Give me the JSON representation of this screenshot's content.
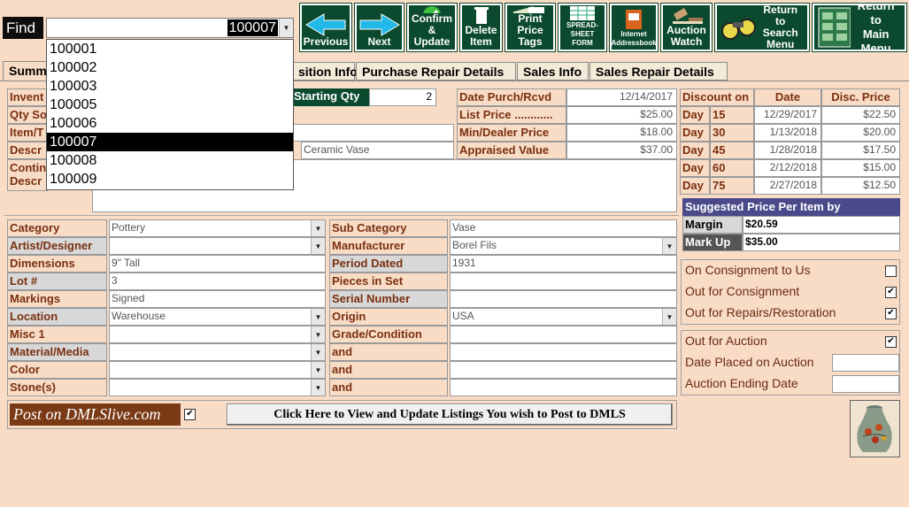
{
  "find": {
    "label": "Find",
    "value": "100007",
    "options": [
      "100001",
      "100002",
      "100003",
      "100005",
      "100006",
      "100007",
      "100008",
      "100009"
    ]
  },
  "toolbar": {
    "previous": "Previous",
    "next": "Next",
    "confirm1": "Confirm",
    "confirm2": "& Update",
    "delete1": "Delete",
    "delete2": "Item",
    "print1": "Print",
    "print2": "Price Tags",
    "spread1": "SPREAD-",
    "spread2": "SHEET",
    "spread3": "FORM",
    "internet1": "Internet",
    "internet2": "Addressbook",
    "auction1": "Auction",
    "auction2": "Watch",
    "search1": "Return to",
    "search2": "Search",
    "search3": "Menu",
    "main1": "Return to",
    "main2": "Main",
    "main3": "Menu"
  },
  "tabs": [
    "Summ",
    "sition Info",
    "Purchase Repair Details",
    "Sales Info",
    "Sales Repair Details"
  ],
  "left_labels": {
    "inventory": "Invent",
    "qty": "Qty So",
    "item": "Item/T",
    "descr": "Descr",
    "contin1": "Contin",
    "contin2": "Descr"
  },
  "starting_qty": {
    "label": "Starting Qty",
    "value": "2"
  },
  "descr_value": "Ceramic Vase",
  "purchase": {
    "date_label": "Date Purch/Rcvd",
    "date": "12/14/2017",
    "list_label": "List  Price ............",
    "list": "$25.00",
    "min_label": "Min/Dealer Price",
    "min": "$18.00",
    "appraised_label": "Appraised Value",
    "appraised": "$37.00"
  },
  "discount": {
    "headers": [
      "Discount on",
      "Date",
      "Disc. Price"
    ],
    "rows": [
      {
        "label": "Day",
        "day": "15",
        "date": "12/29/2017",
        "price": "$22.50"
      },
      {
        "label": "Day",
        "day": "30",
        "date": "1/13/2018",
        "price": "$20.00"
      },
      {
        "label": "Day",
        "day": "45",
        "date": "1/28/2018",
        "price": "$17.50"
      },
      {
        "label": "Day",
        "day": "60",
        "date": "2/12/2018",
        "price": "$15.00"
      },
      {
        "label": "Day",
        "day": "75",
        "date": "2/27/2018",
        "price": "$12.50"
      }
    ]
  },
  "suggested": {
    "title": "Suggested Price Per Item by",
    "margin_label": "Margin",
    "margin": "$20.59",
    "markup_label": "Mark Up",
    "markup": "$35.00"
  },
  "status": {
    "consign_to_us": "On Consignment to Us",
    "out_consign": "Out for Consignment",
    "out_repair": "Out for Repairs/Restoration",
    "out_auction": "Out for Auction",
    "date_placed": "Date Placed on Auction",
    "auction_end": "Auction Ending Date"
  },
  "details_left": [
    {
      "label": "Category",
      "value": "Pottery"
    },
    {
      "label": "Artist/Designer",
      "value": ""
    },
    {
      "label": "Dimensions",
      "value": "9\" Tall"
    },
    {
      "label": "Lot #",
      "value": "3"
    },
    {
      "label": "Markings",
      "value": "Signed"
    },
    {
      "label": "Location",
      "value": "Warehouse"
    },
    {
      "label": "Misc 1",
      "value": ""
    },
    {
      "label": "Material/Media",
      "value": ""
    },
    {
      "label": "Color",
      "value": ""
    },
    {
      "label": "Stone(s)",
      "value": ""
    }
  ],
  "details_right": [
    {
      "label": "Sub Category",
      "value": "Vase"
    },
    {
      "label": "Manufacturer",
      "value": "Borel Fils"
    },
    {
      "label": "Period Dated",
      "value": "1931"
    },
    {
      "label": "Pieces in Set",
      "value": ""
    },
    {
      "label": "Serial Number",
      "value": ""
    },
    {
      "label": "Origin",
      "value": "USA"
    },
    {
      "label": "Grade/Condition",
      "value": ""
    },
    {
      "label": "and",
      "value": ""
    },
    {
      "label": "and",
      "value": ""
    },
    {
      "label": "and",
      "value": ""
    }
  ],
  "dmls": {
    "post_label": "Post on DMLSlive.com",
    "button": "Click Here to View and Update Listings You wish to Post to DMLS"
  }
}
